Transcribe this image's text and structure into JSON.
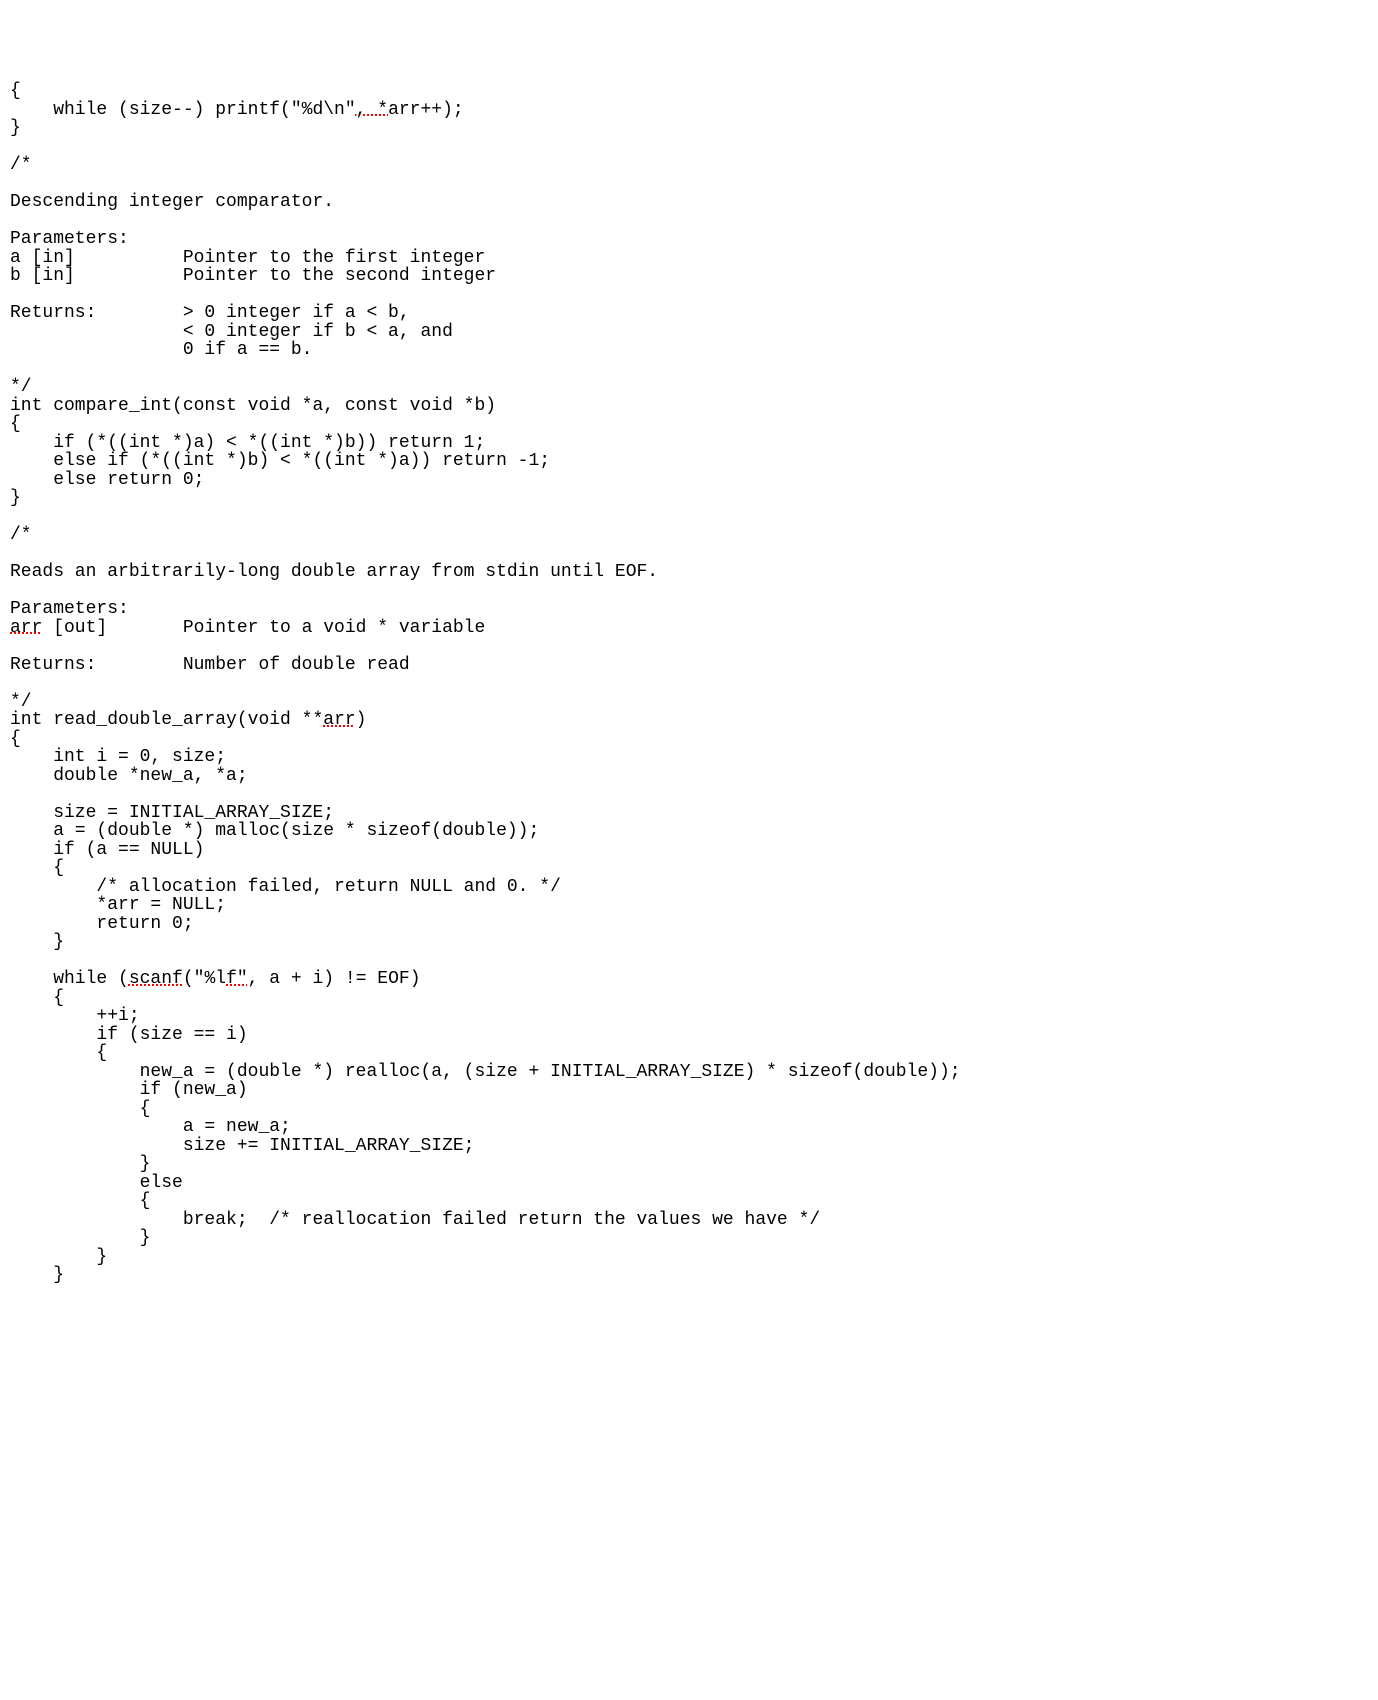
{
  "code": {
    "lines": [
      {
        "text": "{",
        "spellErrors": []
      },
      {
        "text": "    while (size--) printf(\"%d\\n\", *arr++);",
        "spellErrors": [
          {
            "start": 32,
            "end": 35,
            "word": "arr"
          }
        ]
      },
      {
        "text": "}",
        "spellErrors": []
      },
      {
        "text": "",
        "spellErrors": []
      },
      {
        "text": "/*",
        "spellErrors": []
      },
      {
        "text": "",
        "spellErrors": []
      },
      {
        "text": "Descending integer comparator.",
        "spellErrors": []
      },
      {
        "text": "",
        "spellErrors": []
      },
      {
        "text": "Parameters:",
        "spellErrors": []
      },
      {
        "text": "a [in]          Pointer to the first integer",
        "spellErrors": []
      },
      {
        "text": "b [in]          Pointer to the second integer",
        "spellErrors": []
      },
      {
        "text": "",
        "spellErrors": []
      },
      {
        "text": "Returns:        > 0 integer if a < b,",
        "spellErrors": []
      },
      {
        "text": "                < 0 integer if b < a, and",
        "spellErrors": []
      },
      {
        "text": "                0 if a == b.",
        "spellErrors": []
      },
      {
        "text": "",
        "spellErrors": []
      },
      {
        "text": "*/",
        "spellErrors": []
      },
      {
        "text": "int compare_int(const void *a, const void *b)",
        "spellErrors": []
      },
      {
        "text": "{",
        "spellErrors": []
      },
      {
        "text": "    if (*((int *)a) < *((int *)b)) return 1;",
        "spellErrors": []
      },
      {
        "text": "    else if (*((int *)b) < *((int *)a)) return -1;",
        "spellErrors": []
      },
      {
        "text": "    else return 0;",
        "spellErrors": []
      },
      {
        "text": "}",
        "spellErrors": []
      },
      {
        "text": "",
        "spellErrors": []
      },
      {
        "text": "/*",
        "spellErrors": []
      },
      {
        "text": "",
        "spellErrors": []
      },
      {
        "text": "Reads an arbitrarily-long double array from stdin until EOF.",
        "spellErrors": []
      },
      {
        "text": "",
        "spellErrors": []
      },
      {
        "text": "Parameters:",
        "spellErrors": []
      },
      {
        "text": "arr [out]       Pointer to a void * variable",
        "spellErrors": [
          {
            "start": 0,
            "end": 3,
            "word": "arr"
          }
        ]
      },
      {
        "text": "",
        "spellErrors": []
      },
      {
        "text": "Returns:        Number of double read",
        "spellErrors": []
      },
      {
        "text": "",
        "spellErrors": []
      },
      {
        "text": "*/",
        "spellErrors": []
      },
      {
        "text": "int read_double_array(void **arr)",
        "spellErrors": [
          {
            "start": 29,
            "end": 32,
            "word": "arr"
          }
        ]
      },
      {
        "text": "{",
        "spellErrors": []
      },
      {
        "text": "    int i = 0, size;",
        "spellErrors": []
      },
      {
        "text": "    double *new_a, *a;",
        "spellErrors": []
      },
      {
        "text": "",
        "spellErrors": []
      },
      {
        "text": "    size = INITIAL_ARRAY_SIZE;",
        "spellErrors": []
      },
      {
        "text": "    a = (double *) malloc(size * sizeof(double));",
        "spellErrors": []
      },
      {
        "text": "    if (a == NULL)",
        "spellErrors": []
      },
      {
        "text": "    {",
        "spellErrors": []
      },
      {
        "text": "        /* allocation failed, return NULL and 0. */",
        "spellErrors": []
      },
      {
        "text": "        *arr = NULL;",
        "spellErrors": []
      },
      {
        "text": "        return 0;",
        "spellErrors": []
      },
      {
        "text": "    }",
        "spellErrors": []
      },
      {
        "text": "",
        "spellErrors": []
      },
      {
        "text": "    while (scanf(\"%lf\", a + i) != EOF)",
        "spellErrors": [
          {
            "start": 11,
            "end": 16,
            "word": "scanf"
          },
          {
            "start": 20,
            "end": 22,
            "word": "lf"
          }
        ]
      },
      {
        "text": "    {",
        "spellErrors": []
      },
      {
        "text": "        ++i;",
        "spellErrors": []
      },
      {
        "text": "        if (size == i)",
        "spellErrors": []
      },
      {
        "text": "        {",
        "spellErrors": []
      },
      {
        "text": "            new_a = (double *) realloc(a, (size + INITIAL_ARRAY_SIZE) * sizeof(double));",
        "spellErrors": []
      },
      {
        "text": "            if (new_a)",
        "spellErrors": []
      },
      {
        "text": "            {",
        "spellErrors": []
      },
      {
        "text": "                a = new_a;",
        "spellErrors": []
      },
      {
        "text": "                size += INITIAL_ARRAY_SIZE;",
        "spellErrors": []
      },
      {
        "text": "            }",
        "spellErrors": []
      },
      {
        "text": "            else",
        "spellErrors": []
      },
      {
        "text": "            {",
        "spellErrors": []
      },
      {
        "text": "                break;  /* reallocation failed return the values we have */",
        "spellErrors": []
      },
      {
        "text": "            }",
        "spellErrors": []
      },
      {
        "text": "        }",
        "spellErrors": []
      },
      {
        "text": "    }",
        "spellErrors": []
      }
    ]
  }
}
